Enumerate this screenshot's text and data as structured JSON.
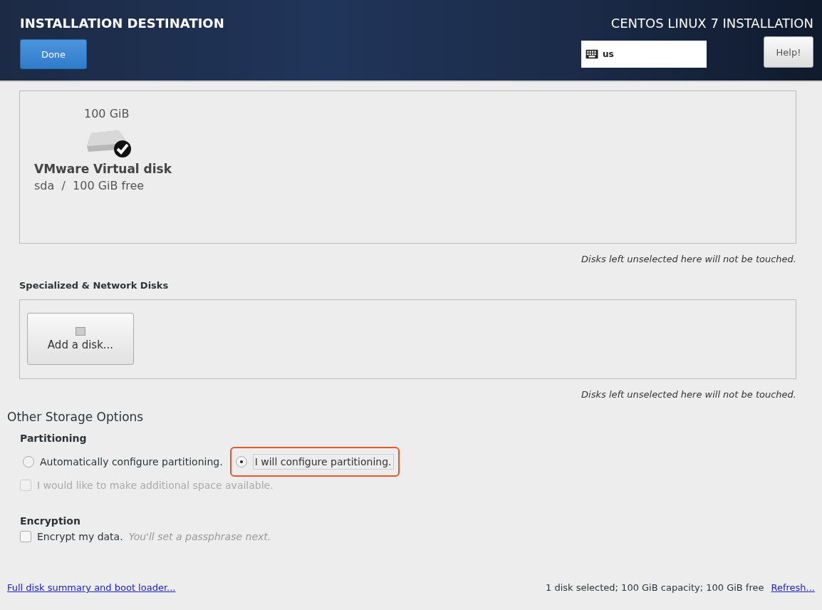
{
  "header": {
    "title": "INSTALLATION DESTINATION",
    "done_button": "Done",
    "product": "CENTOS LINUX 7 INSTALLATION",
    "keyboard_layout": "us",
    "help_button": "Help!"
  },
  "local_disks": {
    "disks": [
      {
        "capacity": "100 GiB",
        "name": "VMware Virtual disk",
        "detail": "sda  /  100 GiB free",
        "selected": true
      }
    ],
    "note": "Disks left unselected here will not be touched."
  },
  "network_disks": {
    "heading": "Specialized & Network Disks",
    "add_button": "Add a disk...",
    "note": "Disks left unselected here will not be touched."
  },
  "other_options": {
    "heading": "Other Storage Options",
    "partitioning": {
      "heading": "Partitioning",
      "options": [
        {
          "label": "Automatically configure partitioning.",
          "selected": false,
          "highlighted": false
        },
        {
          "label": "I will configure partitioning.",
          "selected": true,
          "highlighted": true
        }
      ],
      "extra_space": {
        "label": "I would like to make additional space available.",
        "checked": false,
        "disabled": true
      }
    },
    "encryption": {
      "heading": "Encryption",
      "label": "Encrypt my data.",
      "hint": "You'll set a passphrase next.",
      "checked": false
    }
  },
  "footer": {
    "summary_link": "Full disk summary and boot loader...",
    "status": "1 disk selected; 100 GiB capacity; 100 GiB free",
    "refresh_link": "Refresh..."
  }
}
